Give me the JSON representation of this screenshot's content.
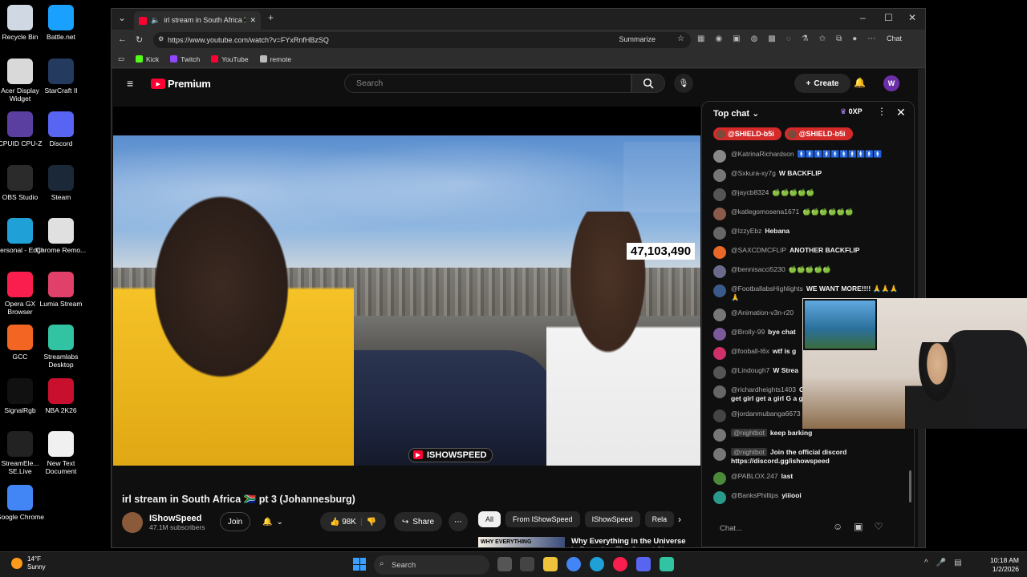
{
  "desktop_icons": [
    {
      "label": "Recycle Bin",
      "icon": "recycle-bin-icon",
      "color": "#cfd8e3"
    },
    {
      "label": "Battle.net",
      "icon": "battlenet-icon",
      "color": "#1aa0ff"
    },
    {
      "label": "Acer Display Widget",
      "icon": "acer-icon",
      "color": "#d9d9d9"
    },
    {
      "label": "StarCraft II",
      "icon": "starcraft-icon",
      "color": "#243a5e"
    },
    {
      "label": "CPUID CPU-Z",
      "icon": "cpuz-icon",
      "color": "#5a3fa0"
    },
    {
      "label": "Discord",
      "icon": "discord-icon",
      "color": "#5865f2"
    },
    {
      "label": "OBS Studio",
      "icon": "obs-icon",
      "color": "#2b2b2b"
    },
    {
      "label": "Steam",
      "icon": "steam-icon",
      "color": "#1b2838"
    },
    {
      "label": "Personal - Edge",
      "icon": "edge-icon",
      "color": "#1fa1d8"
    },
    {
      "label": "Chrome Remo...",
      "icon": "chrome-remote-icon",
      "color": "#e0e0e0"
    },
    {
      "label": "Opera GX Browser",
      "icon": "opera-gx-icon",
      "color": "#fa1e4e"
    },
    {
      "label": "Lumia Stream",
      "icon": "lumia-icon",
      "color": "#e0406a"
    },
    {
      "label": "GCC",
      "icon": "gcc-icon",
      "color": "#f26522"
    },
    {
      "label": "Streamlabs Desktop",
      "icon": "streamlabs-icon",
      "color": "#31c3a2"
    },
    {
      "label": "SignalRgb",
      "icon": "signalrgb-icon",
      "color": "#111111"
    },
    {
      "label": "NBA 2K26",
      "icon": "nba2k-icon",
      "color": "#c8102e"
    },
    {
      "label": "StreamEle... SE.Live",
      "icon": "streamelements-icon",
      "color": "#222222"
    },
    {
      "label": "New Text Document",
      "icon": "text-document-icon",
      "color": "#f0f0f0"
    },
    {
      "label": "Google Chrome",
      "icon": "chrome-icon",
      "color": "#4285f4"
    }
  ],
  "browser": {
    "tab_title": "irl stream in South Africa 🇿🇦 pt",
    "url": "https://www.youtube.com/watch?v=FYxRnfHBzSQ",
    "summarize_label": "Summarize",
    "chat_label": "Chat",
    "bookmarks": [
      {
        "label": "Kick",
        "color": "#53fc18"
      },
      {
        "label": "Twitch",
        "color": "#9146ff"
      },
      {
        "label": "YouTube",
        "color": "#ff0033"
      },
      {
        "label": "remote",
        "color": "#bbbbbb"
      }
    ]
  },
  "youtube": {
    "logo_text": "Premium",
    "search_placeholder": "Search",
    "create_label": "Create",
    "avatar_letter": "W",
    "video": {
      "view_count_overlay": "47,103,490",
      "watermark": "ISHOWSPEED",
      "title": "irl stream in South Africa 🇿🇦 pt 3 (Johannesburg)"
    },
    "channel": {
      "name": "IShowSpeed",
      "subscribers": "47.1M subscribers",
      "join_label": "Join",
      "likes": "98K",
      "share_label": "Share"
    },
    "chips": [
      "All",
      "From IShowSpeed",
      "IShowSpeed",
      "Rela"
    ],
    "recommendation": {
      "thumb_text": "WHY EVERYTHING",
      "title": "Why Everything in the Universe Is Round — The Secret Shape"
    }
  },
  "chat": {
    "header": "Top chat",
    "xp": "0XP",
    "pinned": [
      "@SHIELD-b5i",
      "@SHIELD-b5i"
    ],
    "messages": [
      {
        "user": "@KatrinaRichardson",
        "text": "🚹🚹🚹🚹🚹🚹🚹🚹🚹🚹",
        "color": "#888888"
      },
      {
        "user": "@Sxkura-xy7g",
        "text": "W BACKFLIP",
        "color": "#777777"
      },
      {
        "user": "@jaycb8324",
        "text": "🍏🍏🍏🍏🍏",
        "color": "#555555"
      },
      {
        "user": "@katlegomosena1671",
        "text": "🍏🍏🍏🍏🍏🍏",
        "color": "#8a5a4a"
      },
      {
        "user": "@IzzyEbz",
        "text": "Hebana",
        "color": "#666666"
      },
      {
        "user": "@SAXCDMCFLIP",
        "text": "ANOTHER BACKFLIP",
        "color": "#e8682a"
      },
      {
        "user": "@bennisacci5230",
        "text": "🍏🍏🍏🍏🍏",
        "color": "#6a6a8a"
      },
      {
        "user": "@FootballabsHighlights",
        "text": "WE WANT MORE!!!! 🙏🙏🙏🙏",
        "color": "#3a5a8a"
      },
      {
        "user": "@Animation-v3n-r20",
        "text": "",
        "color": "#777777"
      },
      {
        "user": "@Brolly-99",
        "text": "bye chat",
        "color": "#7a5a9a"
      },
      {
        "user": "@fooball-t6x",
        "text": "wtf is g",
        "color": "#d0306a"
      },
      {
        "user": "@Lindough7",
        "text": "W Strea",
        "color": "#555555"
      },
      {
        "user": "@richardheights1403",
        "text": "Get a girl get a girl get a girl girl get girl get a girl G a girl Get a girl get a g",
        "color": "#666666"
      },
      {
        "user": "@jordanmubanga6673",
        "text": "🍏🍏🍏",
        "color": "#444444"
      },
      {
        "user": "@nightbot",
        "text": "keep barking",
        "color": "#777777",
        "mod": true
      },
      {
        "user": "@nightbot",
        "text": "Join the official discord https://discord.gg/ishowspeed",
        "color": "#777777",
        "mod": true
      },
      {
        "user": "@PABLOX.247",
        "text": "last",
        "color": "#4a8a3a"
      },
      {
        "user": "@BanksPhillips",
        "text": "yiiiooi",
        "color": "#2a9a8a"
      }
    ],
    "input_placeholder": "Chat..."
  },
  "taskbar": {
    "temperature": "14°F",
    "condition": "Sunny",
    "search_label": "Search",
    "time": "10:18 AM",
    "date": "1/2/2026"
  }
}
